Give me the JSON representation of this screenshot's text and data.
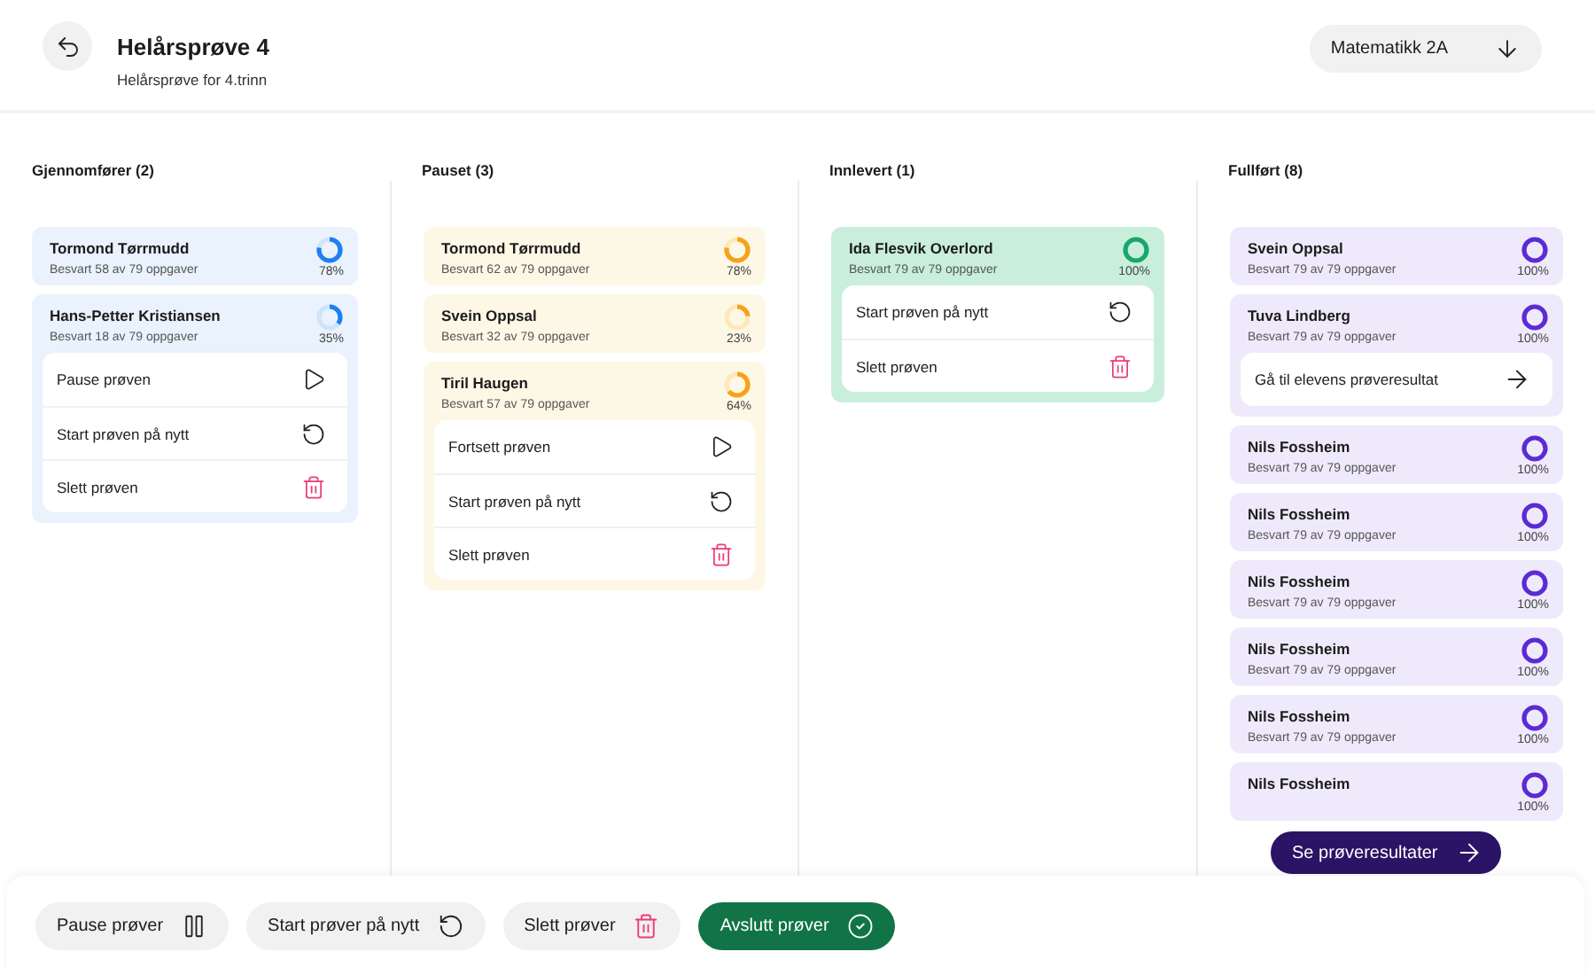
{
  "header": {
    "title": "Helårsprøve 4",
    "subtitle": "Helårsprøve for 4.trinn",
    "class_select": "Matematikk 2A"
  },
  "columns": [
    {
      "kind": "in_progress",
      "title": "Gjennomfører (2)",
      "cards": [
        {
          "name": "Tormond Tørrmudd",
          "answered": "Besvart 58 av 79 oppgaver",
          "percent": "78%",
          "level": 0.78
        },
        {
          "name": "Hans-Petter Kristiansen",
          "answered": "Besvart 18 av 79 oppgaver",
          "percent": "35%",
          "level": 0.35,
          "actions": [
            {
              "label": "Pause prøven",
              "kind": "play"
            },
            {
              "label": "Start prøven på nytt",
              "kind": "restart"
            },
            {
              "label": "Slett prøven",
              "kind": "trash"
            }
          ]
        }
      ]
    },
    {
      "kind": "paused",
      "title": "Pauset (3)",
      "cards": [
        {
          "name": "Tormond Tørrmudd",
          "answered": "Besvart 62 av 79 oppgaver",
          "percent": "78%",
          "level": 0.78
        },
        {
          "name": "Svein Oppsal",
          "answered": "Besvart 32 av 79 oppgaver",
          "percent": "23%",
          "level": 0.23
        },
        {
          "name": "Tiril Haugen",
          "answered": "Besvart 57 av 79 oppgaver",
          "percent": "64%",
          "level": 0.64,
          "actions": [
            {
              "label": "Fortsett prøven",
              "kind": "play"
            },
            {
              "label": "Start prøven på nytt",
              "kind": "restart"
            },
            {
              "label": "Slett prøven",
              "kind": "trash"
            }
          ]
        }
      ]
    },
    {
      "kind": "submitted",
      "title": "Innlevert (1)",
      "cards": [
        {
          "name": "Ida Flesvik Overlord",
          "answered": "Besvart 79 av 79 oppgaver",
          "percent": "100%",
          "level": 1,
          "actions": [
            {
              "label": "Start prøven på nytt",
              "kind": "restart"
            },
            {
              "label": "Slett prøven",
              "kind": "trash"
            }
          ]
        }
      ]
    },
    {
      "kind": "completed",
      "title": "Fullført (8)",
      "cards": [
        {
          "name": "Svein Oppsal",
          "answered": "Besvart 79 av 79 oppgaver",
          "percent": "100%",
          "level": 1
        },
        {
          "name": "Tuva Lindberg",
          "answered": "Besvart 79 av 79 oppgaver",
          "percent": "100%",
          "level": 1,
          "actions": [
            {
              "label": "Gå til elevens prøveresultat",
              "kind": "arrow"
            }
          ]
        },
        {
          "name": "Nils Fossheim",
          "answered": "Besvart 79 av 79 oppgaver",
          "percent": "100%",
          "level": 1
        },
        {
          "name": "Nils Fossheim",
          "answered": "Besvart 79 av 79 oppgaver",
          "percent": "100%",
          "level": 1
        },
        {
          "name": "Nils Fossheim",
          "answered": "Besvart 79 av 79 oppgaver",
          "percent": "100%",
          "level": 1
        },
        {
          "name": "Nils Fossheim",
          "answered": "Besvart 79 av 79 oppgaver",
          "percent": "100%",
          "level": 1
        },
        {
          "name": "Nils Fossheim",
          "answered": "Besvart 79 av 79 oppgaver",
          "percent": "100%",
          "level": 1
        },
        {
          "name": "Nils Fossheim",
          "percent": "100%",
          "level": 1
        }
      ]
    }
  ],
  "results_button": "Se prøveresultater",
  "bottom_actions": [
    {
      "label": "Pause prøver",
      "kind": "pause"
    },
    {
      "label": "Start prøver på nytt",
      "kind": "restart"
    },
    {
      "label": "Slett prøver",
      "kind": "trash"
    },
    {
      "label": "Avslutt prøver",
      "kind": "finish"
    }
  ]
}
